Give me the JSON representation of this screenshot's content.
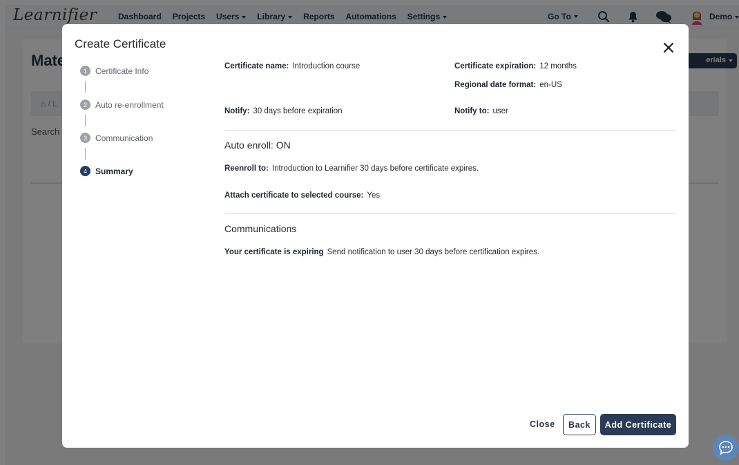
{
  "app": {
    "logo": "Learnifier",
    "nav": [
      {
        "label": "Dashboard",
        "dropdown": false
      },
      {
        "label": "Projects",
        "dropdown": false
      },
      {
        "label": "Users",
        "dropdown": true
      },
      {
        "label": "Library",
        "dropdown": true
      },
      {
        "label": "Reports",
        "dropdown": false
      },
      {
        "label": "Automations",
        "dropdown": false
      },
      {
        "label": "Settings",
        "dropdown": true
      }
    ],
    "goto_label": "Go To",
    "user_label": "Demo",
    "icons": [
      "search-icon",
      "bell-icon",
      "chat-icon",
      "avatar"
    ],
    "page_title": "Mate",
    "breadcrumb": "⌂ / L",
    "search_label": "Search",
    "action_button": "erials"
  },
  "modal": {
    "title": "Create Certificate",
    "close_icon": "close-icon",
    "steps": [
      {
        "number": "1",
        "label": "Certificate Info",
        "active": false
      },
      {
        "number": "2",
        "label": "Auto re-enrollment",
        "active": false
      },
      {
        "number": "3",
        "label": "Communication",
        "active": false
      },
      {
        "number": "4",
        "label": "Summary",
        "active": true
      }
    ],
    "summary": {
      "certificate_name_label": "Certificate name:",
      "certificate_name_value": "Introduction course",
      "expiration_label": "Certificate expiration:",
      "expiration_value": "12 months",
      "date_format_label": "Regional date format:",
      "date_format_value": "en-US",
      "notify_label": "Notify:",
      "notify_value": "30 days before expiration",
      "notify_to_label": "Notify to:",
      "notify_to_value": "user",
      "auto_enroll_title": "Auto enroll: ON",
      "reenroll_label": "Reenroll to:",
      "reenroll_value": "Introduction to Learnifier 30 days before certificate expires.",
      "attach_label": "Attach certificate to selected course:",
      "attach_value": "Yes",
      "communications_title": "Communications",
      "comm_label": "Your certificate is expiring",
      "comm_value": "Send notification to user 30 days before certification expires."
    },
    "buttons": {
      "close": "Close",
      "back": "Back",
      "add": "Add Certificate"
    }
  },
  "colors": {
    "primary": "#2b3a55",
    "active_step": "#263b63",
    "inactive_step": "#9ea1a6",
    "chat_bubble": "#5b86b8"
  }
}
